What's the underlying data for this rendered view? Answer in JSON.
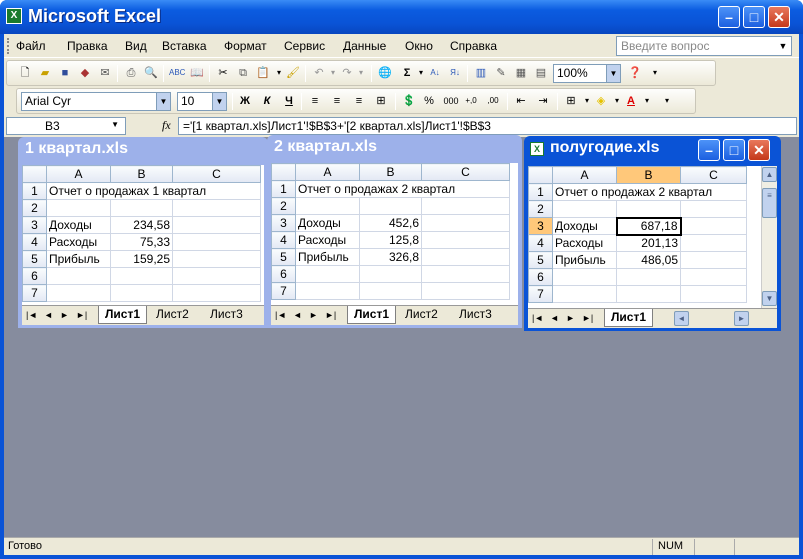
{
  "app": {
    "title": "Microsoft Excel"
  },
  "menu": [
    "Файл",
    "Правка",
    "Вид",
    "Вставка",
    "Формат",
    "Сервис",
    "Данные",
    "Окно",
    "Справка"
  ],
  "help_placeholder": "Введите вопрос",
  "toolbar": {
    "zoom": "100%",
    "font": "Arial Cyr",
    "font_size": "10",
    "bold": "Ж",
    "italic": "К",
    "underline": "Ч",
    "percent": "%",
    "thousands": "000"
  },
  "formula_bar": {
    "name_box": "B3",
    "fx": "fx",
    "formula": "='[1 квартал.xls]Лист1'!$B$3+'[2 квартал.xls]Лист1'!$B$3"
  },
  "workbooks": [
    {
      "title": "1 квартал.xls",
      "columns": [
        "A",
        "B",
        "C"
      ],
      "rows": [
        {
          "n": "1",
          "a": "Отчет о продажах 1 квартал",
          "b": ""
        },
        {
          "n": "2",
          "a": "",
          "b": ""
        },
        {
          "n": "3",
          "a": "Доходы",
          "b": "234,58"
        },
        {
          "n": "4",
          "a": "Расходы",
          "b": "75,33"
        },
        {
          "n": "5",
          "a": "Прибыль",
          "b": "159,25"
        },
        {
          "n": "6",
          "a": "",
          "b": ""
        },
        {
          "n": "7",
          "a": "",
          "b": ""
        }
      ],
      "tabs": [
        "Лист1",
        "Лист2",
        "Лист3"
      ]
    },
    {
      "title": "2 квартал.xls",
      "columns": [
        "A",
        "B",
        "C"
      ],
      "rows": [
        {
          "n": "1",
          "a": "Отчет о продажах 2 квартал",
          "b": ""
        },
        {
          "n": "2",
          "a": "",
          "b": ""
        },
        {
          "n": "3",
          "a": "Доходы",
          "b": "452,6"
        },
        {
          "n": "4",
          "a": "Расходы",
          "b": "125,8"
        },
        {
          "n": "5",
          "a": "Прибыль",
          "b": "326,8"
        },
        {
          "n": "6",
          "a": "",
          "b": ""
        },
        {
          "n": "7",
          "a": "",
          "b": ""
        }
      ],
      "tabs": [
        "Лист1",
        "Лист2",
        "Лист3"
      ]
    },
    {
      "title": "полугодие.xls",
      "columns": [
        "A",
        "B",
        "C"
      ],
      "rows": [
        {
          "n": "1",
          "a": "Отчет о продажах 2 квартал",
          "b": ""
        },
        {
          "n": "2",
          "a": "",
          "b": ""
        },
        {
          "n": "3",
          "a": "Доходы",
          "b": "687,18"
        },
        {
          "n": "4",
          "a": "Расходы",
          "b": "201,13"
        },
        {
          "n": "5",
          "a": "Прибыль",
          "b": "486,05"
        },
        {
          "n": "6",
          "a": "",
          "b": ""
        },
        {
          "n": "7",
          "a": "",
          "b": ""
        }
      ],
      "tabs": [
        "Лист1"
      ]
    }
  ],
  "status": {
    "left": "Готово",
    "num": "NUM"
  }
}
